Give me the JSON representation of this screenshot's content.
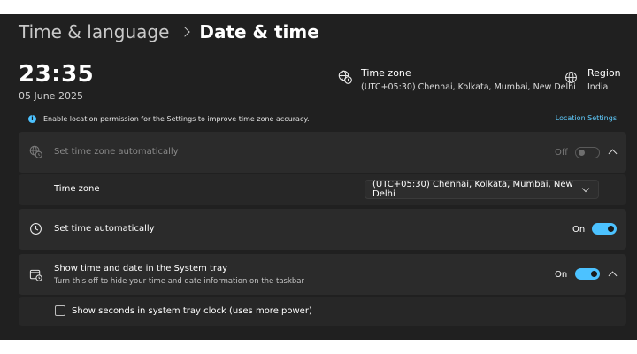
{
  "header": {
    "parent": "Time & language",
    "current": "Date & time"
  },
  "clock": {
    "time": "23:35",
    "date": "05 June 2025"
  },
  "timezone_info": {
    "title": "Time zone",
    "value": "(UTC+05:30) Chennai, Kolkata, Mumbai, New Delhi"
  },
  "region_info": {
    "title": "Region",
    "value": "India"
  },
  "notice": {
    "text": "Enable location permission for the Settings to improve time zone accuracy.",
    "link": "Location Settings"
  },
  "settings": {
    "auto_timezone": {
      "label": "Set time zone automatically",
      "state": "Off",
      "enabled": false,
      "disabled": true
    },
    "timezone_select": {
      "label": "Time zone",
      "value": "(UTC+05:30) Chennai, Kolkata, Mumbai, New Delhi"
    },
    "auto_time": {
      "label": "Set time automatically",
      "state": "On",
      "enabled": true
    },
    "system_tray": {
      "label": "Show time and date in the System tray",
      "description": "Turn this off to hide your time and date information on the taskbar",
      "state": "On",
      "enabled": true
    },
    "seconds_checkbox": {
      "label": "Show seconds in system tray clock (uses more power)",
      "checked": false
    }
  },
  "colors": {
    "background": "#202020",
    "card": "#2b2b2b",
    "accent": "#4cc2ff",
    "link": "#60cdff"
  }
}
